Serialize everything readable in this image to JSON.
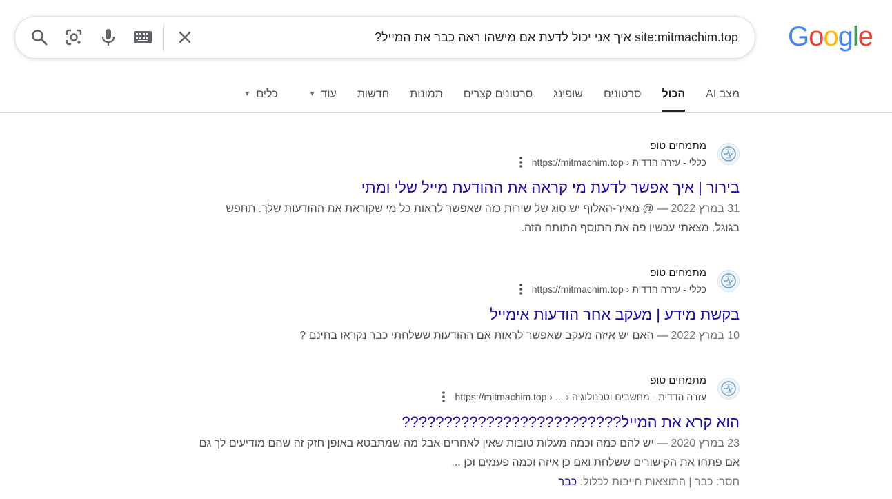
{
  "logo": {
    "letters": [
      "G",
      "o",
      "o",
      "g",
      "l",
      "e"
    ],
    "colors": [
      "#4285F4",
      "#EA4335",
      "#FBBC05",
      "#4285F4",
      "#34A853",
      "#EA4335"
    ]
  },
  "search": {
    "value": "site:mitmachim.top איך אני יכול לדעת אם מישהו ראה כבר את המייל?",
    "icons": {
      "clear": "close-icon",
      "keyboard": "keyboard-icon",
      "mic": "microphone-icon",
      "lens": "camera-lens-icon",
      "search": "search-icon"
    }
  },
  "tabs": [
    {
      "label": "מצב AI"
    },
    {
      "label": "הכול",
      "active": true
    },
    {
      "label": "סרטונים"
    },
    {
      "label": "שופינג"
    },
    {
      "label": "סרטונים קצרים"
    },
    {
      "label": "תמונות"
    },
    {
      "label": "חדשות"
    },
    {
      "label": "עוד"
    },
    {
      "label": "כלים"
    }
  ],
  "results": [
    {
      "site_name": "מתמחים טופ",
      "url": "https://mitmachim.top › כללי - עזרה הדדית",
      "title": "בירור | איך אפשר לדעת מי קראה את ההודעת מייל שלי ומתי",
      "date": "31 במרץ 2022",
      "snippet_lines": [
        "— @ מאיר-האלוף יש סוג של שירות כזה שאפשר לראות כל מי שקוראת את ההודעות שלך. תחפש",
        "בגוגל. מצאתי עכשיו פה את התוסף התותח הזה."
      ]
    },
    {
      "site_name": "מתמחים טופ",
      "url": "https://mitmachim.top › כללי - עזרה הדדית",
      "title": "בקשת מידע | מעקב אחר הודעות אימייל",
      "date": "10 במרץ 2022",
      "snippet_lines": [
        "— האם יש איזה מעקב שאפשר לראות אם ההודעות ששלחתי כבר נקראו בחינם ?"
      ]
    },
    {
      "site_name": "מתמחים טופ",
      "url": "https://mitmachim.top › ... › עזרה הדדית - מחשבים וטכנולוגיה",
      "title": "הוא קרא את המייל??????????????????????????",
      "date": "23 במרץ 2020",
      "snippet_lines": [
        "— יש להם כמה וכמה מעלות טובות שאין לאחרים אבל מה שמתבטא באופן חזק זה שהם מודיעים לך גם",
        "אם פתחו את הקישורים ששלחת ואם כן איזה וכמה פעמים וכן ..."
      ],
      "missing_label": "חסר:",
      "missing_word": "כבר",
      "missing_required_label": "| התוצאות חייבות לכלול:",
      "missing_required_link": "כבר"
    }
  ]
}
